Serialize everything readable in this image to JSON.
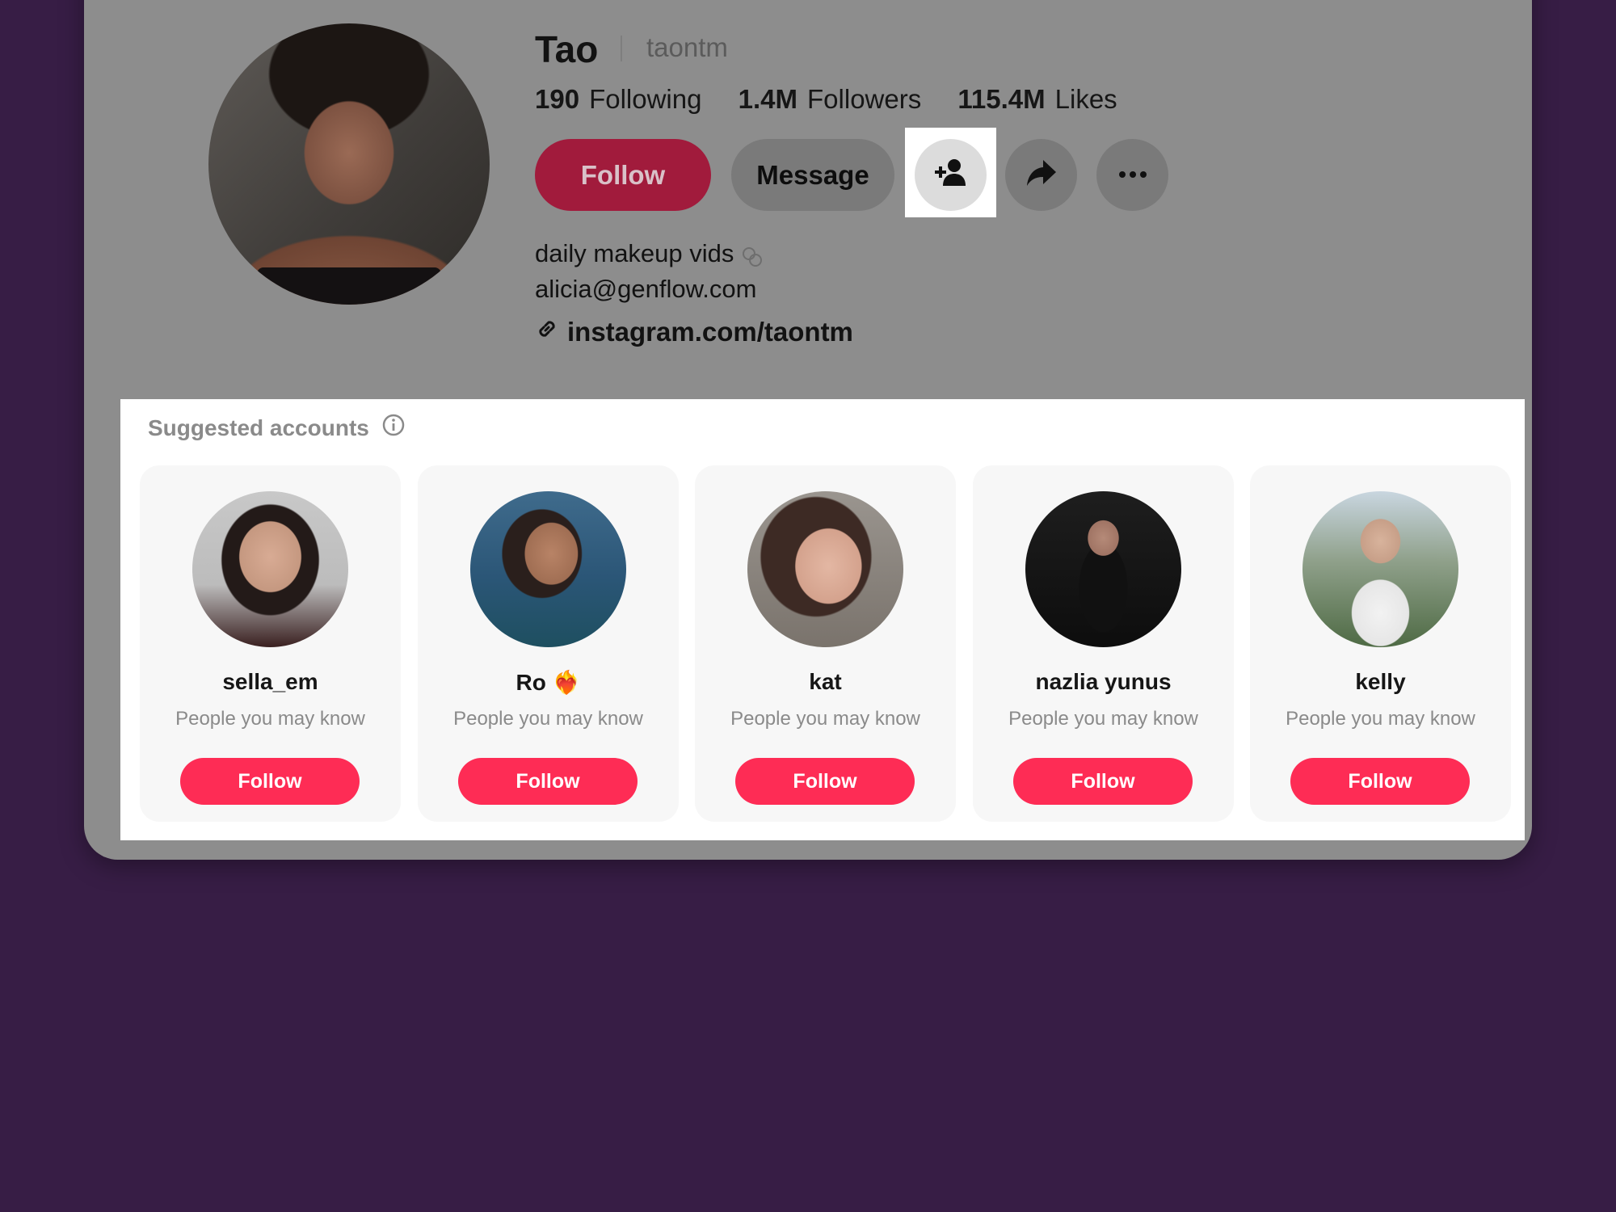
{
  "profile": {
    "display_name": "Tao",
    "username": "taontm",
    "stats": [
      {
        "value": "190",
        "label": "Following"
      },
      {
        "value": "1.4M",
        "label": "Followers"
      },
      {
        "value": "115.4M",
        "label": "Likes"
      }
    ],
    "follow_label": "Follow",
    "message_label": "Message",
    "bio_line1": "daily makeup vids",
    "bio_line2": "alicia@genflow.com",
    "link": "instagram.com/taontm"
  },
  "suggested": {
    "title": "Suggested accounts",
    "accounts": [
      {
        "name": "sella_em",
        "subtitle": "People you may know",
        "button": "Follow"
      },
      {
        "name": "Ro ❤️‍🔥",
        "subtitle": "People you may know",
        "button": "Follow"
      },
      {
        "name": "kat",
        "subtitle": "People you may know",
        "button": "Follow"
      },
      {
        "name": "nazlia yunus",
        "subtitle": "People you may know",
        "button": "Follow"
      },
      {
        "name": "kelly",
        "subtitle": "People you may know",
        "button": "Follow"
      }
    ]
  },
  "colors": {
    "background": "#371d45",
    "follow_primary": "#fe2c55",
    "overlay_gray": "#8d8d8d"
  },
  "icons": [
    "link-icon",
    "add-friend-icon",
    "share-icon",
    "more-icon",
    "info-icon"
  ]
}
